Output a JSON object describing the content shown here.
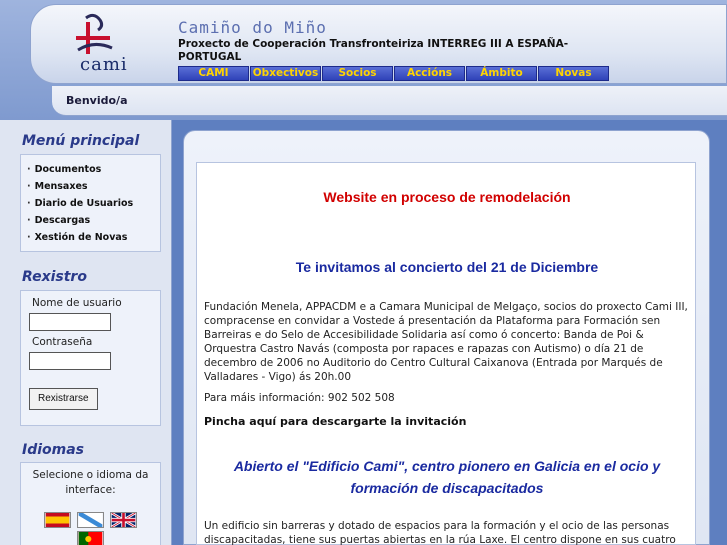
{
  "header": {
    "logo_text": "cami",
    "site_title": "Camiño do Miño",
    "subtitle": "Proxecto de Cooperación Transfronteiriza INTERREG III A ESPAÑA-PORTUGAL",
    "nav": [
      {
        "label": "CAMI"
      },
      {
        "label": "Obxectivos"
      },
      {
        "label": "Socios"
      },
      {
        "label": "Accións"
      },
      {
        "label": "Ámbito"
      },
      {
        "label": "Novas"
      }
    ],
    "welcome": "Benvido/a"
  },
  "sidebar": {
    "menu_heading": "Menú principal",
    "menu_items": [
      {
        "label": "Documentos"
      },
      {
        "label": "Mensaxes"
      },
      {
        "label": "Diario de Usuarios"
      },
      {
        "label": "Descargas"
      },
      {
        "label": "Xestión de Novas"
      }
    ],
    "register_heading": "Rexistro",
    "username_label": "Nome de usuario",
    "username_value": "",
    "password_label": "Contraseña",
    "password_value": "",
    "register_button": "Rexistrarse",
    "languages_heading": "Idiomas",
    "languages_prompt": "Selecione o idioma da interface:",
    "flags": [
      {
        "name": "spain-flag-icon"
      },
      {
        "name": "galicia-flag-icon"
      },
      {
        "name": "uk-flag-icon"
      },
      {
        "name": "portugal-flag-icon"
      }
    ]
  },
  "main": {
    "notice": "Website en proceso de remodelación",
    "concert_heading": "Te invitamos al concierto del 21 de Diciembre",
    "concert_text": "Fundación Menela, APPACDM e a Camara Municipal de Melgaço, socios do proxecto Cami III, compracense en convidar a Vostede á presentación da Plataforma para Formación sen Barreiras e do Selo de Accesibilidade Solidaria así como ó concerto: Banda de Poi & Orquestra Castro Navás (composta por rapaces e rapazas con Autismo) o día 21 de decembro de 2006 no Auditorio do Centro Cultural Caixanova (Entrada por Marqués de Valladares - Vigo) ás 20h.00",
    "info_text": "Para máis información: 902 502 508",
    "download_link": "Pincha aquí para descargarte la invitación",
    "building_heading": "Abierto el \"Edificio Cami\", centro pionero en Galicia en el ocio y formación de discapacitados",
    "building_text": "Un edificio sin barreras y dotado de espacios para la formación y el ocio de las personas discapacitadas, tiene sus puertas abiertas en la rúa Laxe. El centro dispone en sus cuatro"
  },
  "colors": {
    "background": "#5e7fc0",
    "nav_button": "#3a4ec4",
    "nav_text": "#ffd400",
    "notice_red": "#d10000",
    "heading_blue": "#1a2aa0"
  }
}
